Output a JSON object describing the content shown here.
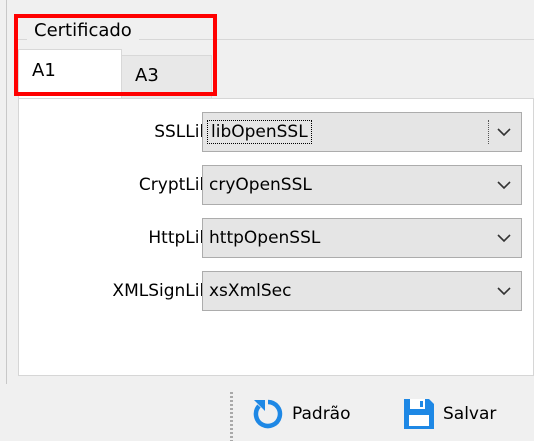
{
  "certificado": {
    "group_title": "Certificado",
    "tabs": [
      {
        "label": "A1",
        "active": true
      },
      {
        "label": "A3",
        "active": false
      }
    ],
    "fields": [
      {
        "label": "SSLLib:",
        "value": "libOpenSSL"
      },
      {
        "label": "CryptLib:",
        "value": "cryOpenSSL"
      },
      {
        "label": "HttpLib:",
        "value": "httpOpenSSL"
      },
      {
        "label": "XMLSignLib:",
        "value": "xsXmlSec"
      }
    ]
  },
  "toolbar": {
    "default_label": "Padrão",
    "save_label": "Salvar"
  },
  "colors": {
    "highlight": "#ff0000",
    "icon_blue": "#1e88e5"
  },
  "icons": {
    "default": "refresh-icon",
    "save": "floppy-disk-icon",
    "dropdown": "chevron-down-icon"
  }
}
